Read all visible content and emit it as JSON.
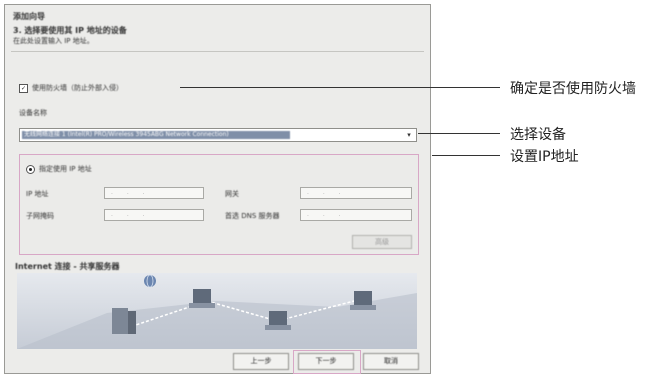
{
  "dialog": {
    "title": "添加向导",
    "step_title": "3. 选择要使用其 IP 地址的设备",
    "step_desc": "在此处设置输入 IP 地址。",
    "firewall_checkbox_label": "使用防火墙（防止外部入侵）",
    "device_label": "设备名称",
    "device_selected": "无线网络连接 1 (Intel(R) PRO/Wireless 3945ABG Network Connection)",
    "ip_radio_label": "指定使用 IP 地址",
    "fields": {
      "ip": "IP 地址",
      "subnet": "子网掩码",
      "gateway": "网关",
      "dns": "首选 DNS 服务器"
    },
    "ip_placeholder": ". . .",
    "ipbox_button": "高级",
    "net_title": "Internet 连接 - 共享服务器",
    "buttons": {
      "back": "上一步",
      "next": "下一步",
      "cancel": "取消"
    }
  },
  "callouts": {
    "firewall": "确定是否使用防火墙",
    "device": "选择设备",
    "ip": "设置IP地址"
  },
  "colors": {
    "highlight": "#d8a7c6",
    "selection": "#7f8fa8"
  }
}
